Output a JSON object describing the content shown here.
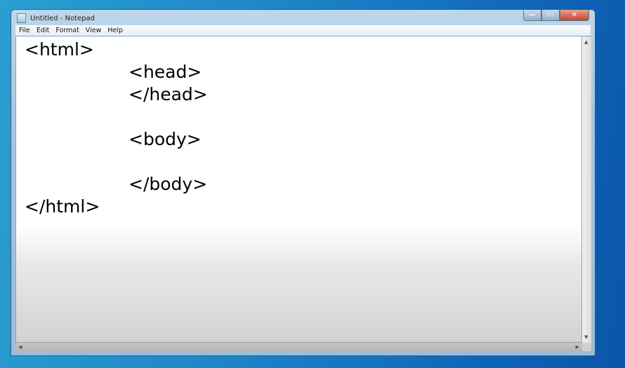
{
  "window": {
    "title": "Untitled - Notepad",
    "controls": {
      "minimize": "—",
      "maximize": "▭",
      "close": "✕"
    }
  },
  "menu": [
    "File",
    "Edit",
    "Format",
    "View",
    "Help"
  ],
  "editor": {
    "lines": [
      "<html>",
      "\t<head>",
      "\t</head>",
      "",
      "\t<body>",
      "",
      "\t</body>",
      "</html>"
    ]
  },
  "scroll": {
    "up": "▲",
    "down": "▼",
    "left": "◀",
    "right": "▶"
  }
}
